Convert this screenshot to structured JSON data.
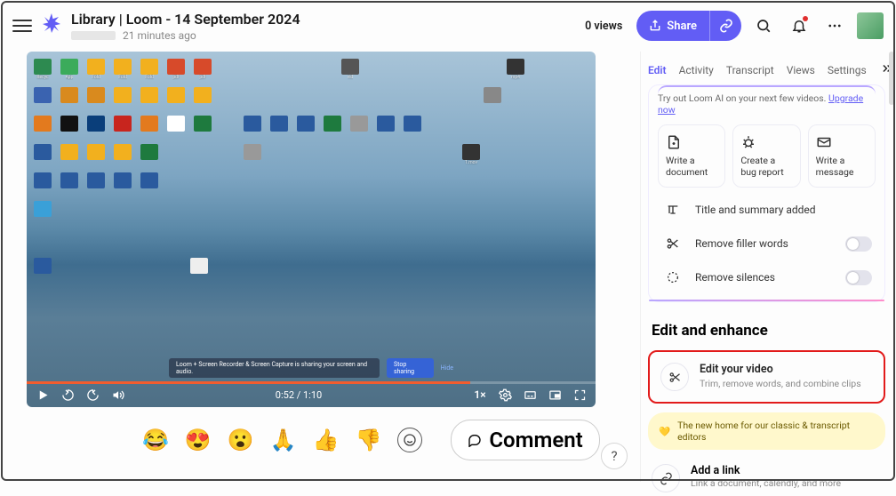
{
  "header": {
    "title": "Library | Loom - 14 September 2024",
    "time_ago": "21 minutes ago",
    "views": "0 views",
    "share_label": "Share"
  },
  "video": {
    "time": "0:52 / 1:10",
    "speed": "1×",
    "banner_text": "Loom + Screen Recorder & Screen Capture is sharing your screen and audio.",
    "stop_label": "Stop sharing",
    "hide_label": "Hide"
  },
  "reactions": {
    "comment_label": "Comment"
  },
  "right": {
    "tabs": [
      "Edit",
      "Activity",
      "Transcript",
      "Views",
      "Settings"
    ],
    "ai_text": "Try out Loom AI on your next few videos. ",
    "ai_link": "Upgrade now",
    "chips": [
      {
        "label": "Write a document"
      },
      {
        "label": "Create a bug report"
      },
      {
        "label": "Write a message"
      }
    ],
    "opt_title_summary": "Title and summary added",
    "opt_filler": "Remove filler words",
    "opt_silence": "Remove silences",
    "section_title": "Edit and enhance",
    "edit_title": "Edit your video",
    "edit_sub": "Trim, remove words, and combine clips",
    "home_pill": "The new home for our classic & transcript editors",
    "link_title": "Add a link",
    "link_sub": "Link a document, calendly, and more"
  },
  "help": "?"
}
